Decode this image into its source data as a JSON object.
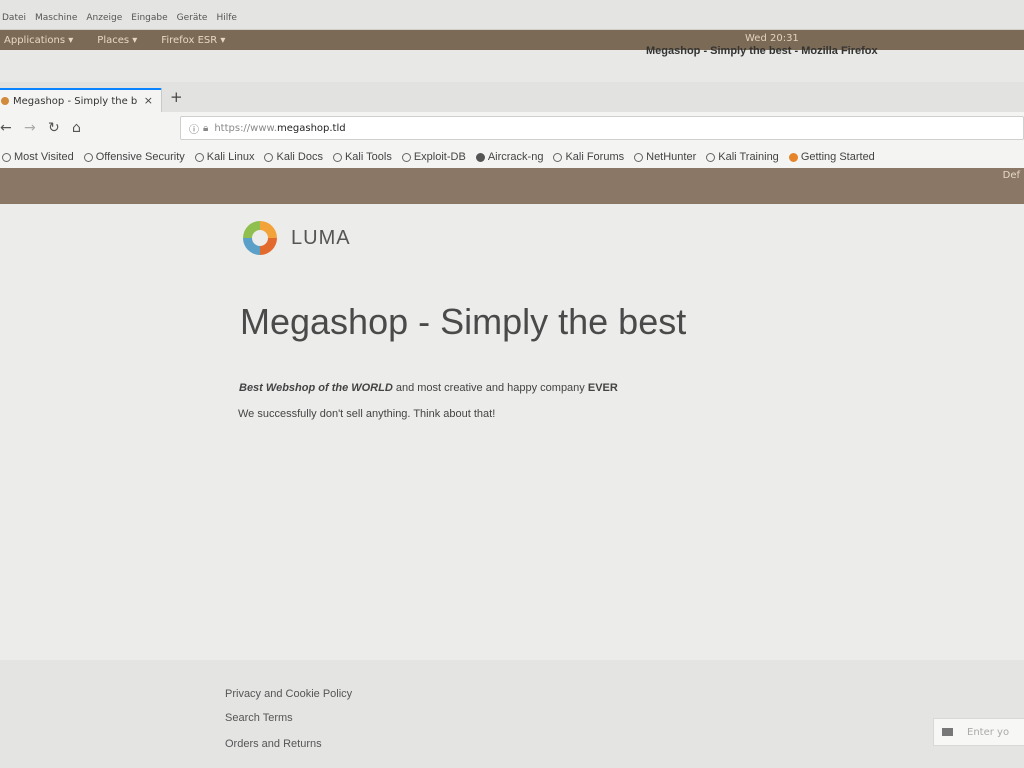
{
  "vm_menu": [
    "Datei",
    "Maschine",
    "Anzeige",
    "Eingabe",
    "Geräte",
    "Hilfe"
  ],
  "panel": {
    "applications": "Applications ▾",
    "places": "Places ▾",
    "active_app": "Firefox ESR ▾",
    "clock": "Wed 20:31"
  },
  "window_title": "Megashop - Simply the best - Mozilla Firefox",
  "tab": {
    "label": "Megashop - Simply the b",
    "close": "×"
  },
  "url": {
    "scheme": "https://www.",
    "host": "megashop.tld"
  },
  "bookmarks": [
    {
      "label": "Most Visited",
      "icon": "gear-icon"
    },
    {
      "label": "Offensive Security",
      "icon": "globe-icon"
    },
    {
      "label": "Kali Linux",
      "icon": "globe-icon"
    },
    {
      "label": "Kali Docs",
      "icon": "globe-icon"
    },
    {
      "label": "Kali Tools",
      "icon": "globe-icon"
    },
    {
      "label": "Exploit-DB",
      "icon": "globe-icon"
    },
    {
      "label": "Aircrack-ng",
      "icon": "bookmark-icon"
    },
    {
      "label": "Kali Forums",
      "icon": "globe-icon"
    },
    {
      "label": "NetHunter",
      "icon": "globe-icon"
    },
    {
      "label": "Kali Training",
      "icon": "globe-icon"
    },
    {
      "label": "Getting Started",
      "icon": "firefox-icon"
    }
  ],
  "brownbar_right": "Def",
  "site": {
    "logo_text": "LUMA",
    "heading": "Megashop - Simply the best",
    "intro": {
      "em": "Best Webshop of the WORLD",
      "middle": " and most creative and happy company ",
      "strong": "EVER"
    },
    "note": "We successfully don't sell anything. Think about that!"
  },
  "footer_links": [
    "Privacy and Cookie Policy",
    "Search Terms",
    "Orders and Returns"
  ],
  "newsletter_placeholder": "Enter yo",
  "colors": {
    "panel": "#7b6a55",
    "accent_tab": "#0a84ff"
  }
}
